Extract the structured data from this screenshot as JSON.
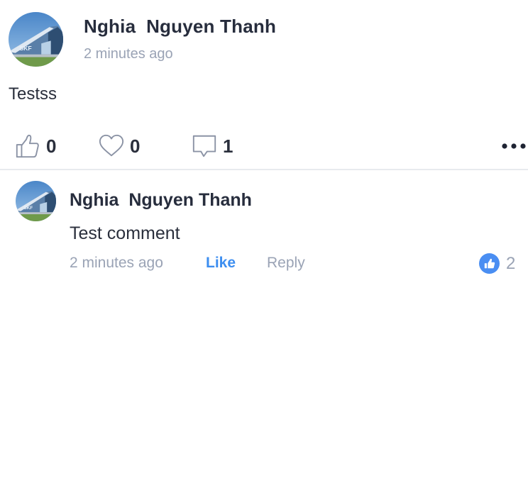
{
  "post": {
    "author": "Nghia  Nguyen Thanh",
    "timestamp": "2 minutes ago",
    "body": "Testss",
    "actions": {
      "like_icon": "thumbs-up-outline-icon",
      "like_count": "0",
      "heart_icon": "heart-outline-icon",
      "heart_count": "0",
      "comment_icon": "comment-bubble-icon",
      "comment_count": "1",
      "more_icon": "more-dots-icon"
    }
  },
  "comment": {
    "author": "Nghia  Nguyen Thanh",
    "body": "Test comment",
    "timestamp": "2 minutes ago",
    "like_label": "Like",
    "reply_label": "Reply",
    "reaction_icon": "thumbs-up-badge-icon",
    "reaction_count": "2"
  },
  "colors": {
    "accent": "#3d8ef0",
    "muted": "#9aa3b5",
    "text": "#272d3d",
    "divider": "#e8eaee"
  }
}
